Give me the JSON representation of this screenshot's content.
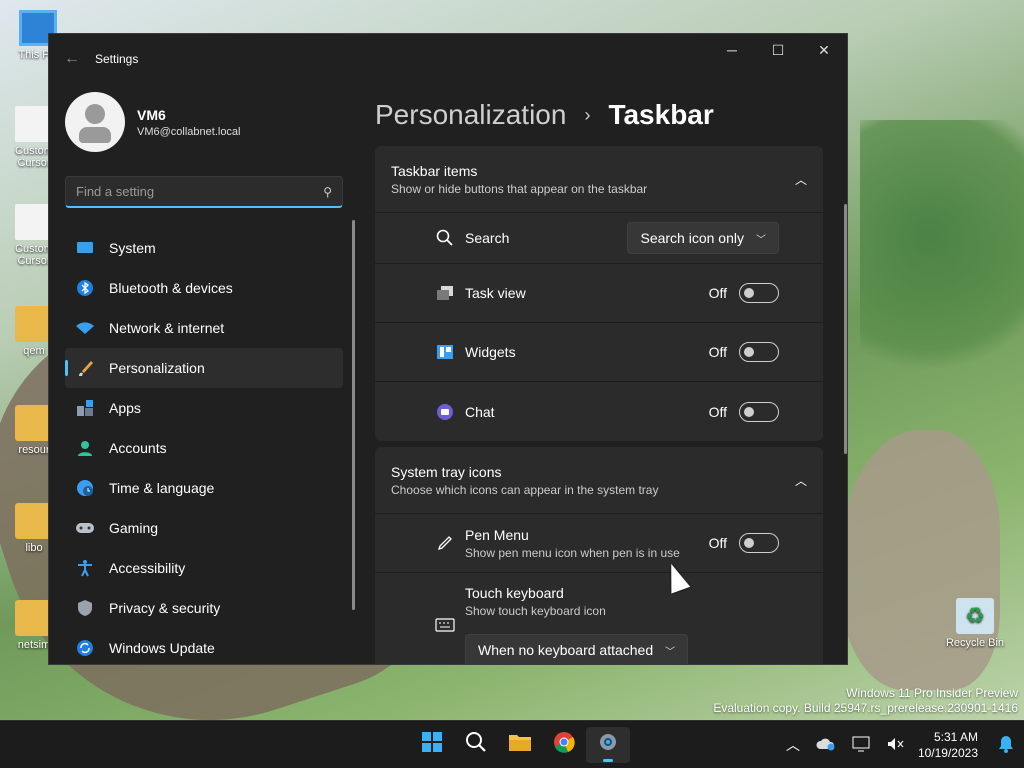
{
  "desktop": {
    "icons": [
      {
        "label": "This PC",
        "kind": "monitor"
      },
      {
        "label": "Custom Cursor",
        "kind": "file"
      },
      {
        "label": "Custom Cursor",
        "kind": "file"
      },
      {
        "label": "qem",
        "kind": "folder"
      },
      {
        "label": "resour",
        "kind": "folder"
      },
      {
        "label": "libo",
        "kind": "folder"
      },
      {
        "label": "netsim",
        "kind": "folder"
      },
      {
        "label": "Recycle Bin",
        "kind": "recycle"
      }
    ],
    "watermark": {
      "line1": "Windows 11 Pro Insider Preview",
      "line2": "Evaluation copy. Build 25947.rs_prerelease.230901-1416"
    }
  },
  "window": {
    "title": "Settings",
    "controls": {
      "minimize": "─",
      "maximize": "☐",
      "close": "✕"
    }
  },
  "profile": {
    "name": "VM6",
    "email": "VM6@collabnet.local"
  },
  "search": {
    "placeholder": "Find a setting"
  },
  "nav": {
    "items": [
      {
        "label": "System",
        "icon": "monitor-icon"
      },
      {
        "label": "Bluetooth & devices",
        "icon": "bluetooth-icon"
      },
      {
        "label": "Network & internet",
        "icon": "wifi-icon"
      },
      {
        "label": "Personalization",
        "icon": "brush-icon"
      },
      {
        "label": "Apps",
        "icon": "apps-icon"
      },
      {
        "label": "Accounts",
        "icon": "person-icon"
      },
      {
        "label": "Time & language",
        "icon": "globe-clock-icon"
      },
      {
        "label": "Gaming",
        "icon": "gamepad-icon"
      },
      {
        "label": "Accessibility",
        "icon": "accessibility-icon"
      },
      {
        "label": "Privacy & security",
        "icon": "shield-icon"
      },
      {
        "label": "Windows Update",
        "icon": "update-icon"
      }
    ],
    "active_index": 3
  },
  "breadcrumb": {
    "parent": "Personalization",
    "separator": "›",
    "current": "Taskbar"
  },
  "taskbar_items": {
    "title": "Taskbar items",
    "subtitle": "Show or hide buttons that appear on the taskbar",
    "search": {
      "label": "Search",
      "value": "Search icon only"
    },
    "task_view": {
      "label": "Task view",
      "state": "Off"
    },
    "widgets": {
      "label": "Widgets",
      "state": "Off"
    },
    "chat": {
      "label": "Chat",
      "state": "Off"
    }
  },
  "system_tray": {
    "title": "System tray icons",
    "subtitle": "Choose which icons can appear in the system tray",
    "pen_menu": {
      "label": "Pen Menu",
      "description": "Show pen menu icon when pen is in use",
      "state": "Off"
    },
    "touch_keyboard": {
      "label": "Touch keyboard",
      "description": "Show touch keyboard icon",
      "value": "When no keyboard attached"
    }
  },
  "taskbar": {
    "apps": [
      {
        "name": "start-button"
      },
      {
        "name": "search-button"
      },
      {
        "name": "file-explorer-button"
      },
      {
        "name": "chrome-button"
      },
      {
        "name": "settings-button",
        "active": true
      }
    ],
    "clock": {
      "time": "5:31 AM",
      "date": "10/19/2023"
    }
  },
  "colors": {
    "accent": "#4cc2ff",
    "window_bg": "#202020",
    "card_bg": "#2b2b2b"
  }
}
